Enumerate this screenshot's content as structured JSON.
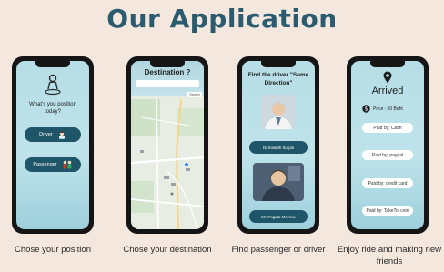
{
  "heading": "Our Application",
  "phone1": {
    "question": "What's you position today?",
    "driver_label": "Driver",
    "passenger_label": "Passenger",
    "caption": "Chose your position"
  },
  "phone2": {
    "title": "Destination ?",
    "search_button": "Search",
    "caption": "Chose your destination"
  },
  "phone3": {
    "title": "Find the driver \"Some Direction\"",
    "driver_name": "Dr.Sownth Surjati",
    "passenger_name": "Mr. Pagata Meymie",
    "caption": "Find passenger or driver"
  },
  "phone4": {
    "title": "Arrived",
    "price": "Price : 50 Baht",
    "pay_options": [
      "Paid by:  Cash",
      "Paid by:  paypal",
      "Paid by:  credit card",
      "Paid by:  TakeTol coin"
    ],
    "caption_line1": "Enjoy ride and making new",
    "caption_line2": "friends"
  },
  "colors": {
    "heading": "#2b5b6e",
    "pill": "#1f5568",
    "background": "#f3e7de"
  }
}
